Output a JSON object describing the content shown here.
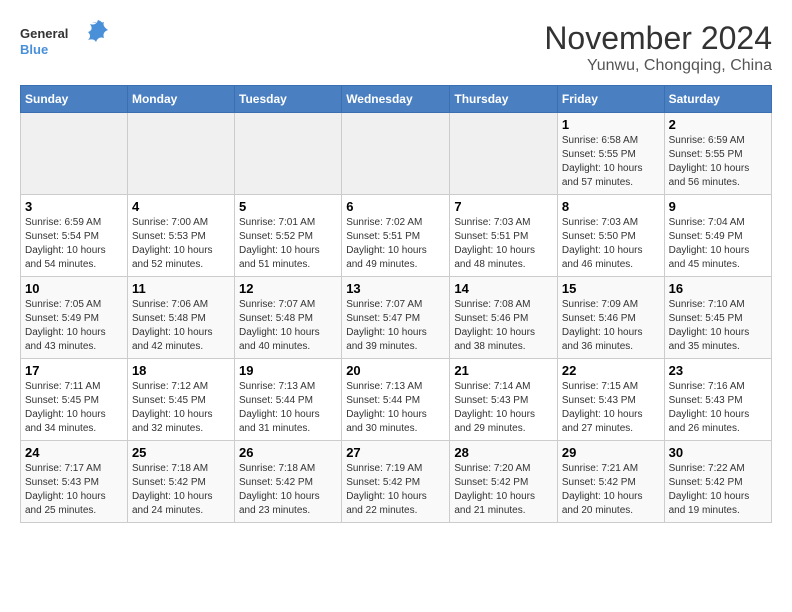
{
  "logo": {
    "text_general": "General",
    "text_blue": "Blue"
  },
  "title": "November 2024",
  "subtitle": "Yunwu, Chongqing, China",
  "weekdays": [
    "Sunday",
    "Monday",
    "Tuesday",
    "Wednesday",
    "Thursday",
    "Friday",
    "Saturday"
  ],
  "weeks": [
    [
      {
        "day": "",
        "sunrise": "",
        "sunset": "",
        "daylight": ""
      },
      {
        "day": "",
        "sunrise": "",
        "sunset": "",
        "daylight": ""
      },
      {
        "day": "",
        "sunrise": "",
        "sunset": "",
        "daylight": ""
      },
      {
        "day": "",
        "sunrise": "",
        "sunset": "",
        "daylight": ""
      },
      {
        "day": "",
        "sunrise": "",
        "sunset": "",
        "daylight": ""
      },
      {
        "day": "1",
        "sunrise": "Sunrise: 6:58 AM",
        "sunset": "Sunset: 5:55 PM",
        "daylight": "Daylight: 10 hours and 57 minutes."
      },
      {
        "day": "2",
        "sunrise": "Sunrise: 6:59 AM",
        "sunset": "Sunset: 5:55 PM",
        "daylight": "Daylight: 10 hours and 56 minutes."
      }
    ],
    [
      {
        "day": "3",
        "sunrise": "Sunrise: 6:59 AM",
        "sunset": "Sunset: 5:54 PM",
        "daylight": "Daylight: 10 hours and 54 minutes."
      },
      {
        "day": "4",
        "sunrise": "Sunrise: 7:00 AM",
        "sunset": "Sunset: 5:53 PM",
        "daylight": "Daylight: 10 hours and 52 minutes."
      },
      {
        "day": "5",
        "sunrise": "Sunrise: 7:01 AM",
        "sunset": "Sunset: 5:52 PM",
        "daylight": "Daylight: 10 hours and 51 minutes."
      },
      {
        "day": "6",
        "sunrise": "Sunrise: 7:02 AM",
        "sunset": "Sunset: 5:51 PM",
        "daylight": "Daylight: 10 hours and 49 minutes."
      },
      {
        "day": "7",
        "sunrise": "Sunrise: 7:03 AM",
        "sunset": "Sunset: 5:51 PM",
        "daylight": "Daylight: 10 hours and 48 minutes."
      },
      {
        "day": "8",
        "sunrise": "Sunrise: 7:03 AM",
        "sunset": "Sunset: 5:50 PM",
        "daylight": "Daylight: 10 hours and 46 minutes."
      },
      {
        "day": "9",
        "sunrise": "Sunrise: 7:04 AM",
        "sunset": "Sunset: 5:49 PM",
        "daylight": "Daylight: 10 hours and 45 minutes."
      }
    ],
    [
      {
        "day": "10",
        "sunrise": "Sunrise: 7:05 AM",
        "sunset": "Sunset: 5:49 PM",
        "daylight": "Daylight: 10 hours and 43 minutes."
      },
      {
        "day": "11",
        "sunrise": "Sunrise: 7:06 AM",
        "sunset": "Sunset: 5:48 PM",
        "daylight": "Daylight: 10 hours and 42 minutes."
      },
      {
        "day": "12",
        "sunrise": "Sunrise: 7:07 AM",
        "sunset": "Sunset: 5:48 PM",
        "daylight": "Daylight: 10 hours and 40 minutes."
      },
      {
        "day": "13",
        "sunrise": "Sunrise: 7:07 AM",
        "sunset": "Sunset: 5:47 PM",
        "daylight": "Daylight: 10 hours and 39 minutes."
      },
      {
        "day": "14",
        "sunrise": "Sunrise: 7:08 AM",
        "sunset": "Sunset: 5:46 PM",
        "daylight": "Daylight: 10 hours and 38 minutes."
      },
      {
        "day": "15",
        "sunrise": "Sunrise: 7:09 AM",
        "sunset": "Sunset: 5:46 PM",
        "daylight": "Daylight: 10 hours and 36 minutes."
      },
      {
        "day": "16",
        "sunrise": "Sunrise: 7:10 AM",
        "sunset": "Sunset: 5:45 PM",
        "daylight": "Daylight: 10 hours and 35 minutes."
      }
    ],
    [
      {
        "day": "17",
        "sunrise": "Sunrise: 7:11 AM",
        "sunset": "Sunset: 5:45 PM",
        "daylight": "Daylight: 10 hours and 34 minutes."
      },
      {
        "day": "18",
        "sunrise": "Sunrise: 7:12 AM",
        "sunset": "Sunset: 5:45 PM",
        "daylight": "Daylight: 10 hours and 32 minutes."
      },
      {
        "day": "19",
        "sunrise": "Sunrise: 7:13 AM",
        "sunset": "Sunset: 5:44 PM",
        "daylight": "Daylight: 10 hours and 31 minutes."
      },
      {
        "day": "20",
        "sunrise": "Sunrise: 7:13 AM",
        "sunset": "Sunset: 5:44 PM",
        "daylight": "Daylight: 10 hours and 30 minutes."
      },
      {
        "day": "21",
        "sunrise": "Sunrise: 7:14 AM",
        "sunset": "Sunset: 5:43 PM",
        "daylight": "Daylight: 10 hours and 29 minutes."
      },
      {
        "day": "22",
        "sunrise": "Sunrise: 7:15 AM",
        "sunset": "Sunset: 5:43 PM",
        "daylight": "Daylight: 10 hours and 27 minutes."
      },
      {
        "day": "23",
        "sunrise": "Sunrise: 7:16 AM",
        "sunset": "Sunset: 5:43 PM",
        "daylight": "Daylight: 10 hours and 26 minutes."
      }
    ],
    [
      {
        "day": "24",
        "sunrise": "Sunrise: 7:17 AM",
        "sunset": "Sunset: 5:43 PM",
        "daylight": "Daylight: 10 hours and 25 minutes."
      },
      {
        "day": "25",
        "sunrise": "Sunrise: 7:18 AM",
        "sunset": "Sunset: 5:42 PM",
        "daylight": "Daylight: 10 hours and 24 minutes."
      },
      {
        "day": "26",
        "sunrise": "Sunrise: 7:18 AM",
        "sunset": "Sunset: 5:42 PM",
        "daylight": "Daylight: 10 hours and 23 minutes."
      },
      {
        "day": "27",
        "sunrise": "Sunrise: 7:19 AM",
        "sunset": "Sunset: 5:42 PM",
        "daylight": "Daylight: 10 hours and 22 minutes."
      },
      {
        "day": "28",
        "sunrise": "Sunrise: 7:20 AM",
        "sunset": "Sunset: 5:42 PM",
        "daylight": "Daylight: 10 hours and 21 minutes."
      },
      {
        "day": "29",
        "sunrise": "Sunrise: 7:21 AM",
        "sunset": "Sunset: 5:42 PM",
        "daylight": "Daylight: 10 hours and 20 minutes."
      },
      {
        "day": "30",
        "sunrise": "Sunrise: 7:22 AM",
        "sunset": "Sunset: 5:42 PM",
        "daylight": "Daylight: 10 hours and 19 minutes."
      }
    ]
  ]
}
